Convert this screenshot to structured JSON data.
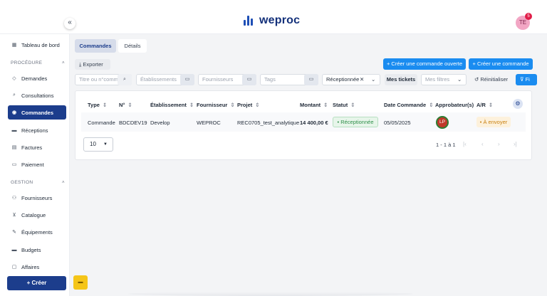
{
  "app": {
    "name": "weproc",
    "user_initials": "TE",
    "notification_count": "5"
  },
  "sidebar": {
    "collapse_label": "«",
    "items": [
      {
        "label": "Tableau de bord",
        "icon": "grid-icon"
      },
      {
        "label": "Demandes",
        "icon": "tag-icon"
      },
      {
        "label": "Consultations",
        "icon": "search-icon"
      },
      {
        "label": "Commandes",
        "icon": "orders-icon"
      },
      {
        "label": "Réceptions",
        "icon": "truck-icon"
      },
      {
        "label": "Factures",
        "icon": "invoice-icon"
      },
      {
        "label": "Paiement",
        "icon": "card-icon"
      },
      {
        "label": "Fournisseurs",
        "icon": "supplier-icon"
      },
      {
        "label": "Catalogue",
        "icon": "cart-icon"
      },
      {
        "label": "Équipements",
        "icon": "wrench-icon"
      },
      {
        "label": "Budgets",
        "icon": "wallet-icon"
      },
      {
        "label": "Affaires",
        "icon": "folder-icon"
      }
    ],
    "sections": {
      "procedure": "PROCÉDURE",
      "gestion": "GESTION"
    },
    "create_label": "+ Créer"
  },
  "tabs": [
    {
      "label": "Commandes"
    },
    {
      "label": "Détails"
    }
  ],
  "toolbar": {
    "export_label": "Exporter",
    "create_open_order": "Créer une commande ouverte",
    "create_order": "Créer une commande"
  },
  "filters": {
    "search_placeholder": "Titre ou n°comm",
    "etablissements": "Établissements",
    "fournisseurs": "Fournisseurs",
    "tags": "Tags",
    "status_selected": "Réceptionnée",
    "mes_tickets": "Mes tickets",
    "mes_filtres": "Mes filtres",
    "reset": "Réinitialiser",
    "filter_btn": "Fi"
  },
  "table": {
    "columns": [
      "Type",
      "N°",
      "Établissement",
      "Fournisseur",
      "Projet",
      "Montant",
      "Statut",
      "Date Commande",
      "Approbateur(s)",
      "A/R"
    ],
    "rows": [
      {
        "type": "Commande",
        "number": "BDCDEV19",
        "etablissement": "Develop",
        "fournisseur": "WEPROC",
        "projet": "REC0705_test_analytique",
        "montant": "14 400,00 €",
        "statut": "Réceptionnée",
        "date": "05/05/2025",
        "approbateur": "LP",
        "ar": "À envoyer"
      }
    ]
  },
  "pagination": {
    "page_size": "10",
    "range": "1 - 1 à 1"
  },
  "colors": {
    "primary": "#1c3d8c",
    "accent": "#1a8cf0",
    "success": "#2f8f4a",
    "warning": "#c98212"
  }
}
